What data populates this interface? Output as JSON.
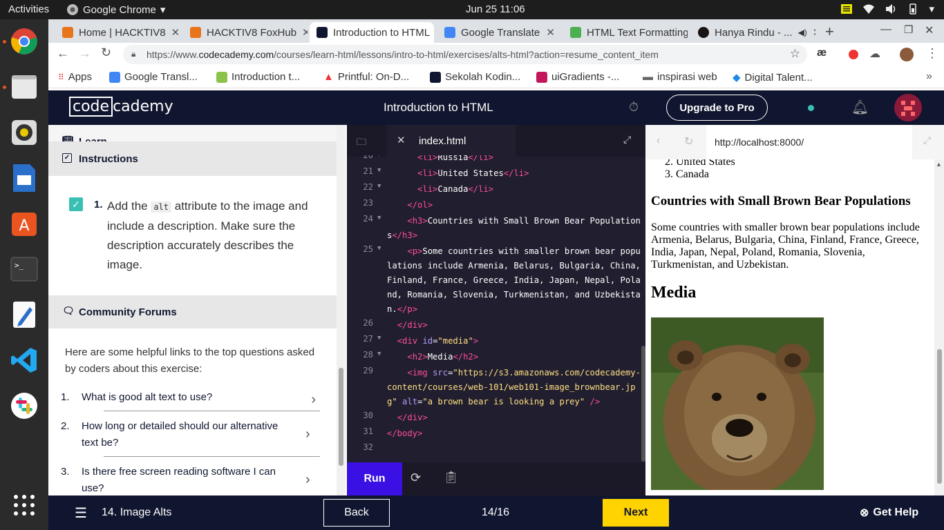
{
  "system": {
    "activities": "Activities",
    "app_name": "Google Chrome",
    "clock": "Jun 25  11:06"
  },
  "tabs": [
    {
      "label": "Home | HACKTIV8",
      "favicon_color": "#e8741c"
    },
    {
      "label": "HACKTIV8 FoxHub",
      "favicon_color": "#e8741c"
    },
    {
      "label": "Introduction to HTML",
      "favicon_color": "#10162f"
    },
    {
      "label": "Google Translate",
      "favicon_color": "#4285f4"
    },
    {
      "label": "HTML Text Formatting",
      "favicon_color": "#4caf50"
    },
    {
      "label": "Hanya Rindu - ...",
      "favicon_color": "#191414"
    }
  ],
  "address": {
    "scheme": "https://www.",
    "host": "codecademy.com",
    "path": "/courses/learn-html/lessons/intro-to-html/exercises/alts-html?action=resume_content_item"
  },
  "bookmarks": [
    "Apps",
    "Google Transl...",
    "Introduction t...",
    "Printful: On-D...",
    "Sekolah Kodin...",
    "uiGradients -...",
    "inspirasi web",
    "Digital Talent..."
  ],
  "header": {
    "logo_left": "code",
    "logo_right": "cademy",
    "title": "Introduction to HTML",
    "upgrade": "Upgrade to Pro"
  },
  "learn": {
    "learn_label": "Learn",
    "instructions_label": "Instructions",
    "task_number": "1.",
    "task_text_before": "Add the ",
    "task_code": "alt",
    "task_text_after": " attribute to the image and include a description. Make sure the description accurately describes the image.",
    "forums_label": "Community Forums",
    "forums_intro": "Here are some helpful links to the top questions asked by coders about this exercise:",
    "forum_links": [
      {
        "num": "1.",
        "text": "What is good alt text to use?"
      },
      {
        "num": "2.",
        "text": "How long or detailed should our alternative text be?"
      },
      {
        "num": "3.",
        "text": "Is there free screen reading software I can use?"
      }
    ]
  },
  "editor": {
    "filename": "index.html",
    "run": "Run",
    "lines": {
      "l20": "20",
      "l21": "21",
      "l22": "22",
      "l23": "23",
      "l24": "24",
      "l25": "25",
      "l26": "26",
      "l27": "27",
      "l28": "28",
      "l29": "29",
      "l30": "30",
      "l31": "31",
      "l32": "32"
    },
    "c20": "Russia",
    "c21": "United States",
    "c22": "Canada",
    "c24": "Countries with Small Brown Bear Populations",
    "c25": "Some countries with smaller brown bear populations include Armenia, Belarus, Bulgaria, China, Finland, France, Greece, India, Japan, Nepal, Poland, Romania, Slovenia, Turkmenistan, and Uzbekistan.",
    "c27_id": "\"media\"",
    "c28": "Media",
    "c29_src": "\"https://s3.amazonaws.com/codecademy-content/courses/web-101/web101-image_brownbear.jpg\"",
    "c29_alt": "\"a brown bear is looking a prey\""
  },
  "preview": {
    "url": "http://localhost:8000/",
    "list_item_2": "United States",
    "list_item_3": "Canada",
    "list_num_2": "2.",
    "list_num_3": "3.",
    "h3": "Countries with Small Brown Bear Populations",
    "paragraph": "Some countries with smaller brown bear populations include Armenia, Belarus, Bulgaria, China, Finland, France, Greece, India, Japan, Nepal, Poland, Romania, Slovenia, Turkmenistan, and Uzbekistan.",
    "h2": "Media"
  },
  "footer": {
    "lesson": "14. Image Alts",
    "back": "Back",
    "progress": "14/16",
    "next": "Next",
    "help": "Get Help"
  },
  "colors": {
    "brand_navy": "#10162f",
    "run_purple": "#3a10e5",
    "next_yellow": "#ffd300",
    "check_teal": "#39c0b2"
  }
}
